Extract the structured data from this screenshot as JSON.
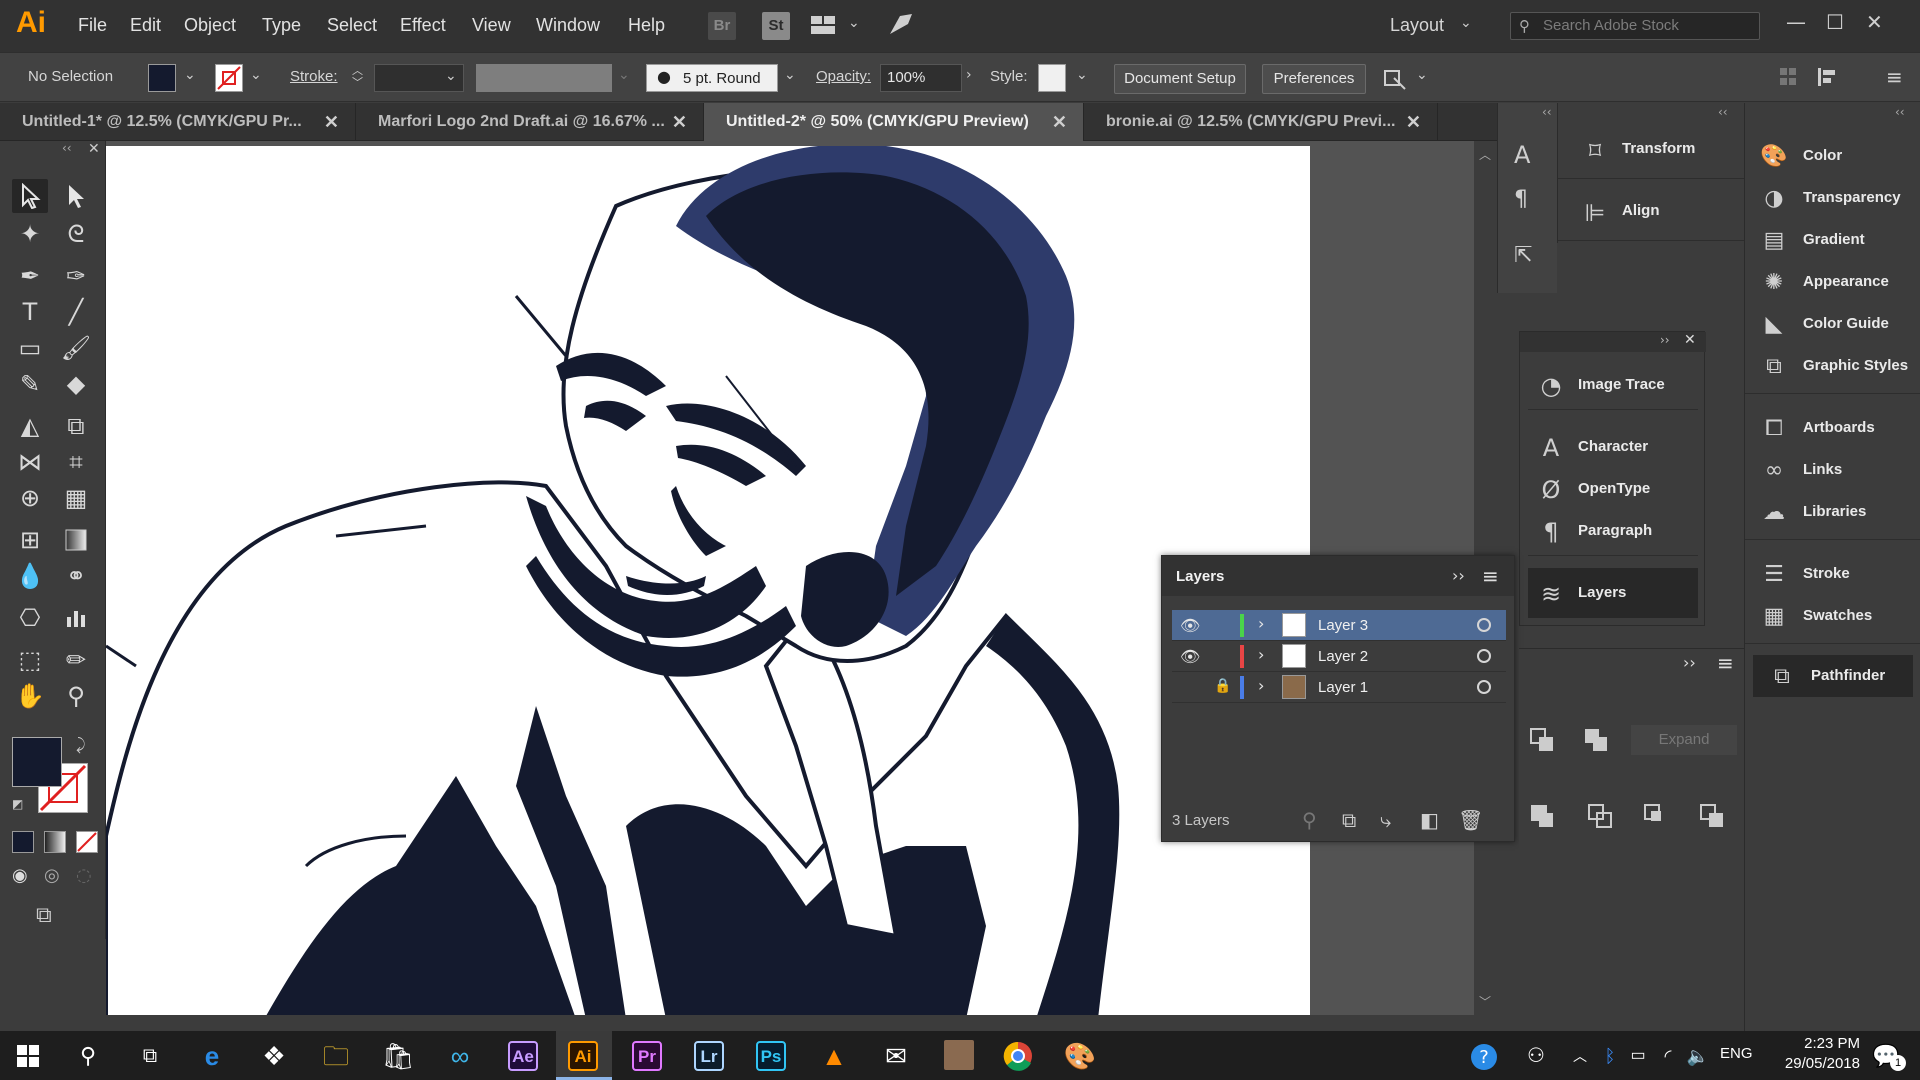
{
  "app": {
    "logo": "Ai",
    "menu": [
      "File",
      "Edit",
      "Object",
      "Type",
      "Select",
      "Effect",
      "View",
      "Window",
      "Help"
    ],
    "bridge_label": "Br",
    "stock_label": "St",
    "workspace": "Layout",
    "search_placeholder": "Search Adobe Stock"
  },
  "control_bar": {
    "selection": "No Selection",
    "stroke_label": "Stroke:",
    "brush": "5 pt. Round",
    "opacity_label": "Opacity:",
    "opacity_value": "100%",
    "style_label": "Style:",
    "document_setup": "Document Setup",
    "preferences": "Preferences"
  },
  "tabs": [
    {
      "label": "Untitled-1* @ 12.5% (CMYK/GPU Pr...",
      "active": false
    },
    {
      "label": "Marfori Logo 2nd Draft.ai @ 16.67% ...",
      "active": false
    },
    {
      "label": "Untitled-2* @ 50% (CMYK/GPU Preview)",
      "active": true
    },
    {
      "label": "bronie.ai @ 12.5% (CMYK/GPU Previ...",
      "active": false
    }
  ],
  "dock_top": [
    {
      "label": "Transform",
      "icon": "transform-icon"
    },
    {
      "label": "Align",
      "icon": "align-icon"
    }
  ],
  "float_panels": [
    {
      "label": "Image Trace",
      "icon": "image-trace-icon"
    },
    {
      "label": "Character",
      "icon": "character-icon"
    },
    {
      "label": "OpenType",
      "icon": "opentype-icon"
    },
    {
      "label": "Paragraph",
      "icon": "paragraph-icon"
    },
    {
      "label": "Layers",
      "icon": "layers-icon"
    }
  ],
  "right_panels": [
    {
      "label": "Color",
      "icon": "color-icon"
    },
    {
      "label": "Transparency",
      "icon": "transparency-icon"
    },
    {
      "label": "Gradient",
      "icon": "gradient-icon"
    },
    {
      "label": "Appearance",
      "icon": "appearance-icon"
    },
    {
      "label": "Color Guide",
      "icon": "color-guide-icon"
    },
    {
      "label": "Graphic Styles",
      "icon": "graphic-styles-icon"
    },
    {
      "label": "Artboards",
      "icon": "artboards-icon"
    },
    {
      "label": "Links",
      "icon": "links-icon"
    },
    {
      "label": "Libraries",
      "icon": "libraries-icon"
    },
    {
      "label": "Stroke",
      "icon": "stroke-icon"
    },
    {
      "label": "Swatches",
      "icon": "swatches-icon"
    },
    {
      "label": "Pathfinder",
      "icon": "pathfinder-icon"
    }
  ],
  "layers_panel": {
    "title": "Layers",
    "layers": [
      {
        "name": "Layer 3",
        "visible": true,
        "locked": false,
        "color": "#4ad44a",
        "selected": true
      },
      {
        "name": "Layer 2",
        "visible": true,
        "locked": false,
        "color": "#e84545",
        "selected": false
      },
      {
        "name": "Layer 1",
        "visible": false,
        "locked": true,
        "color": "#4a7de8",
        "selected": false
      }
    ],
    "count": "3 Layers"
  },
  "pathfinder": {
    "expand_label": "Expand"
  },
  "taskbar": {
    "apps": [
      "Ae",
      "Ai",
      "Pr",
      "Lr",
      "Ps"
    ],
    "language": "ENG",
    "time": "2:23 PM",
    "date": "29/05/2018",
    "notifications": "1"
  },
  "colors": {
    "art_navy": "#141a2e",
    "art_blue": "#2e3b6b",
    "accent_orange": "#ff9a00",
    "selection_blue": "#4e6a94"
  }
}
